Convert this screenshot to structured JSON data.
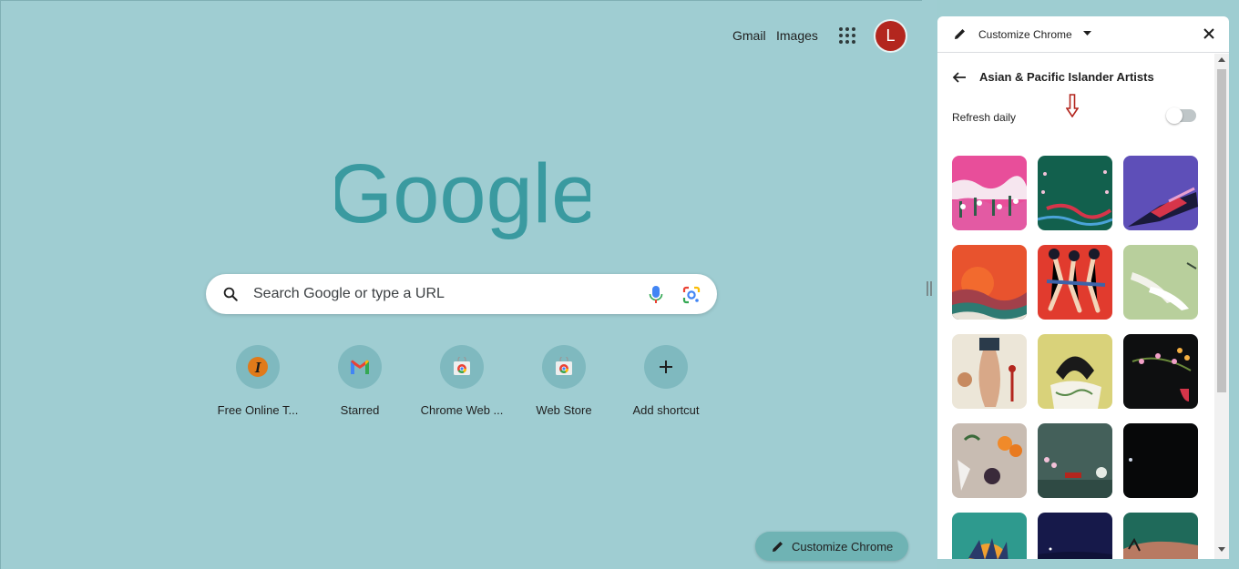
{
  "header": {
    "gmail_label": "Gmail",
    "images_label": "Images",
    "avatar_letter": "L",
    "apps_icon": "apps-grid-icon"
  },
  "logo": {
    "text": "Google"
  },
  "search": {
    "placeholder": "Search Google or type a URL",
    "icons": [
      "search-icon",
      "mic-icon",
      "lens-icon"
    ]
  },
  "shortcuts": [
    {
      "label": "Free Online T...",
      "icon": "favicon-t-icon"
    },
    {
      "label": "Starred",
      "icon": "gmail-icon"
    },
    {
      "label": "Chrome Web ...",
      "icon": "chrome-web-store-icon"
    },
    {
      "label": "Web Store",
      "icon": "chrome-web-store-icon"
    },
    {
      "label": "Add shortcut",
      "icon": "plus-icon"
    }
  ],
  "customize_button": {
    "label": "Customize Chrome"
  },
  "panel": {
    "title": "Customize Chrome",
    "collection_title": "Asian & Pacific Islander Artists",
    "refresh_label": "Refresh daily",
    "refresh_daily_on": false
  },
  "colors": {
    "page_bg": "#9fcdd2",
    "logo_color": "#3a9aa0",
    "avatar": "#b3261e"
  }
}
